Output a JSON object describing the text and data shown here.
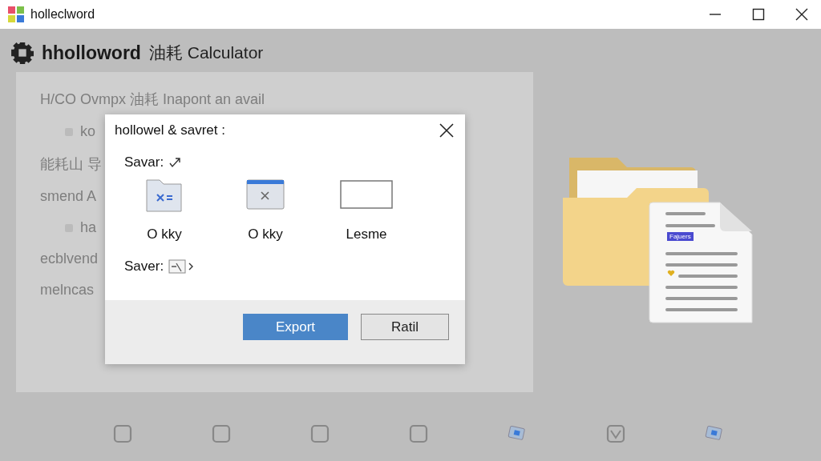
{
  "window": {
    "title": "holleclword"
  },
  "header": {
    "title": "hholloword",
    "subtitle": "油耗 Calculator"
  },
  "background_lines": [
    {
      "text": "H/CO Ovmpx 油耗 Inapont an avail",
      "kind": "heading"
    },
    {
      "text": "ko",
      "kind": "item"
    },
    {
      "text": "能耗山 导",
      "kind": "heading"
    },
    {
      "text": "smend A",
      "kind": "heading"
    },
    {
      "text": "ha",
      "kind": "item"
    },
    {
      "text": "ecblvend",
      "kind": "heading"
    },
    {
      "text": "melncas",
      "kind": "heading"
    }
  ],
  "dialog": {
    "title": "hollowel & savret :",
    "save_label": "Savar:",
    "options": [
      {
        "label": "O kky",
        "kind": "folder"
      },
      {
        "label": "O kky",
        "kind": "window"
      },
      {
        "label": "Lesme",
        "kind": "blank"
      }
    ],
    "saver_label": "Saver:",
    "buttons": [
      {
        "label": "Export",
        "kind": "primary"
      },
      {
        "label": "Ratil",
        "kind": "secondary"
      }
    ]
  },
  "illustration": {
    "doc_label": "Fajuers"
  },
  "bottom_icons": [
    {
      "kind": "square"
    },
    {
      "kind": "square"
    },
    {
      "kind": "square"
    },
    {
      "kind": "square"
    },
    {
      "kind": "screen"
    },
    {
      "kind": "check"
    },
    {
      "kind": "screen"
    }
  ]
}
